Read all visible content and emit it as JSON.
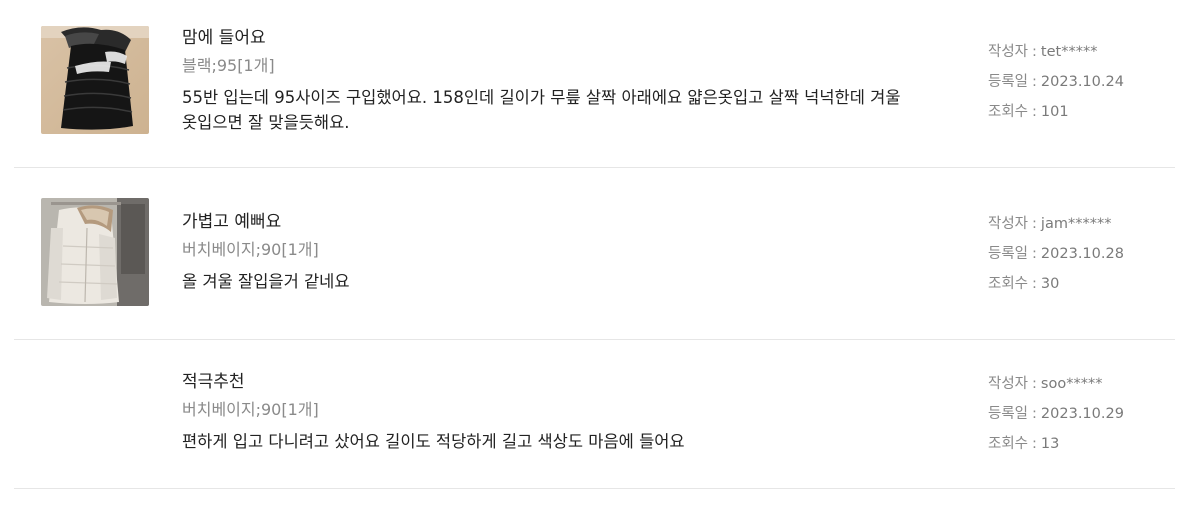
{
  "reviews": [
    {
      "title": "맘에 들어요",
      "option": "블랙;95[1개]",
      "body": "55반 입는데 95사이즈 구입했어요. 158인데 길이가 무릎 살짝 아래에요 얇은옷입고 살짝 넉넉한데 겨울 옷입으면 잘 맞을듯해요.",
      "author_label": "작성자",
      "author": "tet*****",
      "date_label": "등록일",
      "date": "2023.10.24",
      "views_label": "조회수",
      "views": "101",
      "separator": ":",
      "thumbnail": "black-padded-coat-photo"
    },
    {
      "title": "가볍고 예뻐요",
      "option": "버치베이지;90[1개]",
      "body": "올 겨울 잘입을거 같네요",
      "author_label": "작성자",
      "author": "jam******",
      "date_label": "등록일",
      "date": "2023.10.28",
      "views_label": "조회수",
      "views": "30",
      "separator": ":",
      "thumbnail": "beige-padded-coat-photo"
    },
    {
      "title": "적극추천",
      "option": "버치베이지;90[1개]",
      "body": "편하게 입고 다니려고 샀어요 길이도 적당하게 길고 색상도 마음에 들어요",
      "author_label": "작성자",
      "author": "soo*****",
      "date_label": "등록일",
      "date": "2023.10.29",
      "views_label": "조회수",
      "views": "13",
      "separator": ":"
    }
  ],
  "colors": {
    "text": "#222222",
    "muted": "#8a8a8a",
    "divider": "#e6e6e6"
  }
}
